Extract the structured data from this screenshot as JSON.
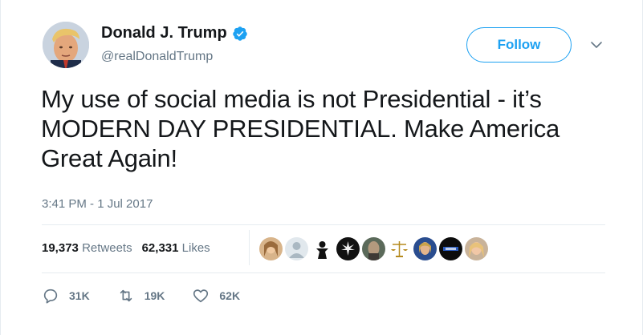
{
  "author": {
    "name": "Donald J. Trump",
    "handle": "@realDonaldTrump",
    "verified_icon": "verified-badge-icon"
  },
  "follow_label": "Follow",
  "tweet": {
    "text": "My use of social media is not Presidential - it’s MODERN DAY PRESIDENTIAL. Make America Great Again!",
    "timestamp": "3:41 PM - 1 Jul 2017"
  },
  "stats": {
    "retweets_count": "19,373",
    "retweets_label": "Retweets",
    "likes_count": "62,331",
    "likes_label": "Likes"
  },
  "likers_count_shown": 9,
  "actions": {
    "reply_count": "31K",
    "retweet_count": "19K",
    "like_count": "62K"
  },
  "colors": {
    "accent": "#1da1f2",
    "muted": "#657786",
    "text": "#14171a",
    "border": "#e6ecf0"
  }
}
